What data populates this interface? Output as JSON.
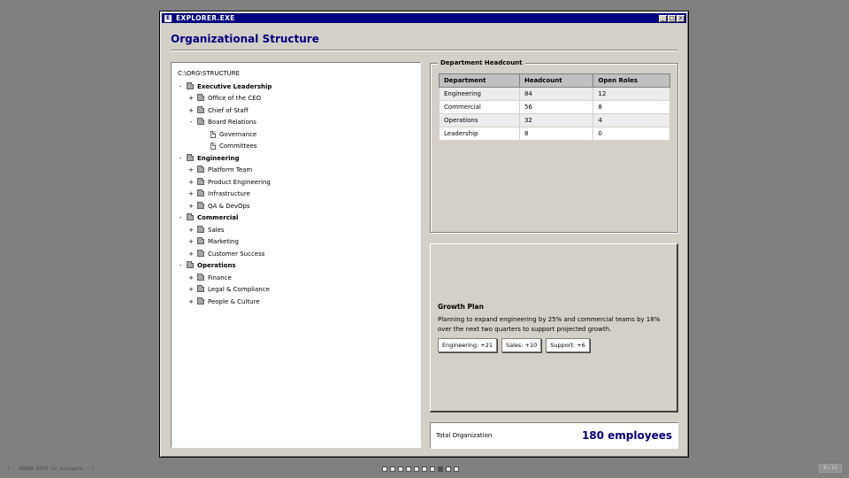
{
  "window": {
    "title": "EXPLORER.EXE",
    "app_icon": "E",
    "controls": [
      "_",
      "□",
      "x"
    ]
  },
  "page_title": "Organizational Structure",
  "tree": {
    "path": "C:\\ORG\\STRUCTURE",
    "nodes": [
      {
        "label": "Executive Leadership",
        "level": 0,
        "toggle": "-",
        "icon": "folder-icon"
      },
      {
        "label": "Office of the CEO",
        "level": 1,
        "toggle": "+",
        "icon": "folder-icon"
      },
      {
        "label": "Chief of Staff",
        "level": 1,
        "toggle": "+",
        "icon": "folder-icon"
      },
      {
        "label": "Board Relations",
        "level": 1,
        "toggle": "-",
        "icon": "folder-icon"
      },
      {
        "label": "Governance",
        "level": 2,
        "toggle": "",
        "icon": "document-icon"
      },
      {
        "label": "Committees",
        "level": 2,
        "toggle": "",
        "icon": "document-icon"
      },
      {
        "label": "Engineering",
        "level": 0,
        "toggle": "-",
        "icon": "folder-icon"
      },
      {
        "label": "Platform Team",
        "level": 1,
        "toggle": "+",
        "icon": "folder-icon"
      },
      {
        "label": "Product Engineering",
        "level": 1,
        "toggle": "+",
        "icon": "folder-icon"
      },
      {
        "label": "Infrastructure",
        "level": 1,
        "toggle": "+",
        "icon": "folder-icon"
      },
      {
        "label": "QA & DevOps",
        "level": 1,
        "toggle": "+",
        "icon": "folder-icon"
      },
      {
        "label": "Commercial",
        "level": 0,
        "toggle": "-",
        "icon": "folder-icon"
      },
      {
        "label": "Sales",
        "level": 1,
        "toggle": "+",
        "icon": "folder-icon"
      },
      {
        "label": "Marketing",
        "level": 1,
        "toggle": "+",
        "icon": "folder-icon"
      },
      {
        "label": "Customer Success",
        "level": 1,
        "toggle": "+",
        "icon": "folder-icon"
      },
      {
        "label": "Operations",
        "level": 0,
        "toggle": "-",
        "icon": "folder-icon"
      },
      {
        "label": "Finance",
        "level": 1,
        "toggle": "+",
        "icon": "folder-icon"
      },
      {
        "label": "Legal & Compliance",
        "level": 1,
        "toggle": "+",
        "icon": "folder-icon"
      },
      {
        "label": "People & Culture",
        "level": 1,
        "toggle": "+",
        "icon": "folder-icon"
      }
    ]
  },
  "headcount": {
    "legend": "Department Headcount",
    "columns": [
      "Department",
      "Headcount",
      "Open Roles"
    ],
    "rows": [
      [
        "Engineering",
        "84",
        "12"
      ],
      [
        "Commercial",
        "56",
        "8"
      ],
      [
        "Operations",
        "32",
        "4"
      ],
      [
        "Leadership",
        "8",
        "0"
      ]
    ]
  },
  "growth": {
    "title": "Growth Plan",
    "text": "Planning to expand engineering by 25% and commercial teams by 18% over the next two quarters to support projected growth.",
    "chips": [
      "Engineering: +21",
      "Sales: +10",
      "Support: +6"
    ]
  },
  "total": {
    "label": "Total Organization",
    "value": "180 employees"
  },
  "footer": {
    "hint": "(-- ARROW KEYS to navigate --)",
    "slide_count": 10,
    "active_slide": 8,
    "counter": "8 / 10"
  },
  "colors": {
    "desktop": "#808080",
    "window": "#d4d0c8",
    "titlebar": "#000080",
    "accent_text": "#000080"
  }
}
